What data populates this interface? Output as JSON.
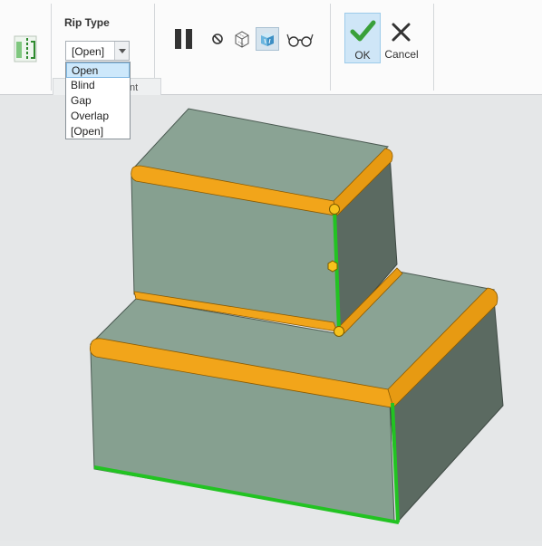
{
  "rip_panel": {
    "title": "Rip Type",
    "selected": "[Open]",
    "options": [
      "Open",
      "Blind",
      "Gap",
      "Overlap",
      "[Open]"
    ]
  },
  "tabs": {
    "partial_label": "nt"
  },
  "toolbar": {
    "pause_icon": "pause-icon",
    "no_preview_icon": "circle-slash-icon",
    "preview_icon": "wireframe-cube-icon",
    "verify_icon": "shaded-cube-icon",
    "glasses_icon": "glasses-icon"
  },
  "actions": {
    "ok_label": "OK",
    "cancel_label": "Cancel"
  },
  "colors": {
    "accent": "#5ab35a",
    "bend": "#f2a51a",
    "part": "#86a090",
    "rip_edge": "#22c322"
  }
}
